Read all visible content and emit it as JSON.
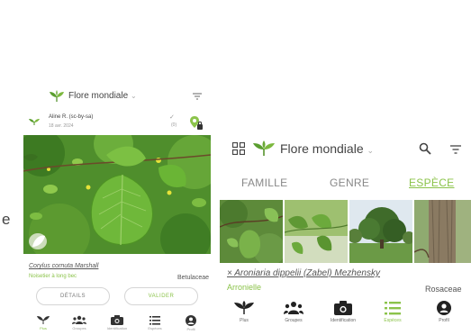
{
  "stray_text": "e",
  "colors": {
    "accent": "#8bc34a",
    "leaf": "#5a9e2f",
    "text": "#444444",
    "muted": "#999999"
  },
  "left_screen": {
    "header": {
      "title": "Flore mondiale",
      "caret": "⌄"
    },
    "observation": {
      "user_name": "Aline R. (sc-by-sa)",
      "date": "18 avr. 2024",
      "check_mark": "✓",
      "check_count": "(0)"
    },
    "species": {
      "scientific_name": "Corylus cornuta Marshall",
      "common_name": "Noisetier à long bec",
      "family": "Betulaceae"
    },
    "buttons": {
      "details": "DÉTAILS",
      "validate": "VALIDER"
    },
    "nav": [
      {
        "label": "Plus",
        "icon": "plant-icon",
        "active": true
      },
      {
        "label": "Groupes",
        "icon": "groups-icon",
        "active": false
      },
      {
        "label": "Identification",
        "icon": "camera-icon",
        "active": false
      },
      {
        "label": "Espèces",
        "icon": "list-icon",
        "active": false
      },
      {
        "label": "Profil",
        "icon": "profile-icon",
        "active": false
      }
    ]
  },
  "right_screen": {
    "header": {
      "title": "Flore mondiale",
      "caret": "⌄"
    },
    "tabs": [
      {
        "label": "FAMILLE",
        "active": false
      },
      {
        "label": "GENRE",
        "active": false
      },
      {
        "label": "ESPÈCE",
        "active": true
      }
    ],
    "species": {
      "scientific_name": "× Aroniaria dippelii (Zabel) Mezhensky",
      "common_name": "Arronielle",
      "family": "Rosaceae"
    },
    "nav": [
      {
        "label": "Plus",
        "icon": "plant-icon",
        "active": false
      },
      {
        "label": "Groupes",
        "icon": "groups-icon",
        "active": false
      },
      {
        "label": "Identification",
        "icon": "camera-icon",
        "active": false
      },
      {
        "label": "Espèces",
        "icon": "list-icon",
        "active": true
      },
      {
        "label": "Profil",
        "icon": "profile-icon",
        "active": false
      }
    ]
  }
}
